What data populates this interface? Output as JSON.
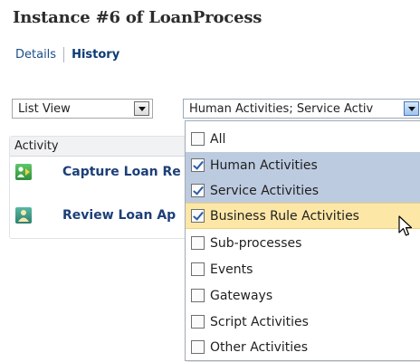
{
  "page": {
    "title": "Instance #6 of LoanProcess"
  },
  "tabs": {
    "details": "Details",
    "history": "History"
  },
  "view_select": {
    "value": "List View"
  },
  "filter_select": {
    "value": "Human Activities; Service Activ"
  },
  "table": {
    "column": "Activity",
    "rows": [
      {
        "label": "Capture Loan Re",
        "icon": "human-activity-icon"
      },
      {
        "label": "Review Loan Ap",
        "icon": "human-task-icon"
      }
    ]
  },
  "filter_options": [
    {
      "label": "All",
      "checked": false,
      "state": "normal"
    },
    {
      "label": "Human Activities",
      "checked": true,
      "state": "selected"
    },
    {
      "label": "Service Activities",
      "checked": true,
      "state": "selected"
    },
    {
      "label": "Business Rule Activities",
      "checked": true,
      "state": "hover"
    },
    {
      "label": "Sub-processes",
      "checked": false,
      "state": "normal"
    },
    {
      "label": "Events",
      "checked": false,
      "state": "normal"
    },
    {
      "label": "Gateways",
      "checked": false,
      "state": "normal"
    },
    {
      "label": "Script Activities",
      "checked": false,
      "state": "normal"
    },
    {
      "label": "Other Activities",
      "checked": false,
      "state": "normal"
    }
  ],
  "colors": {
    "link": "#1c3f78",
    "selected_bg": "#bccbe0",
    "hover_bg": "#fde7a7"
  }
}
